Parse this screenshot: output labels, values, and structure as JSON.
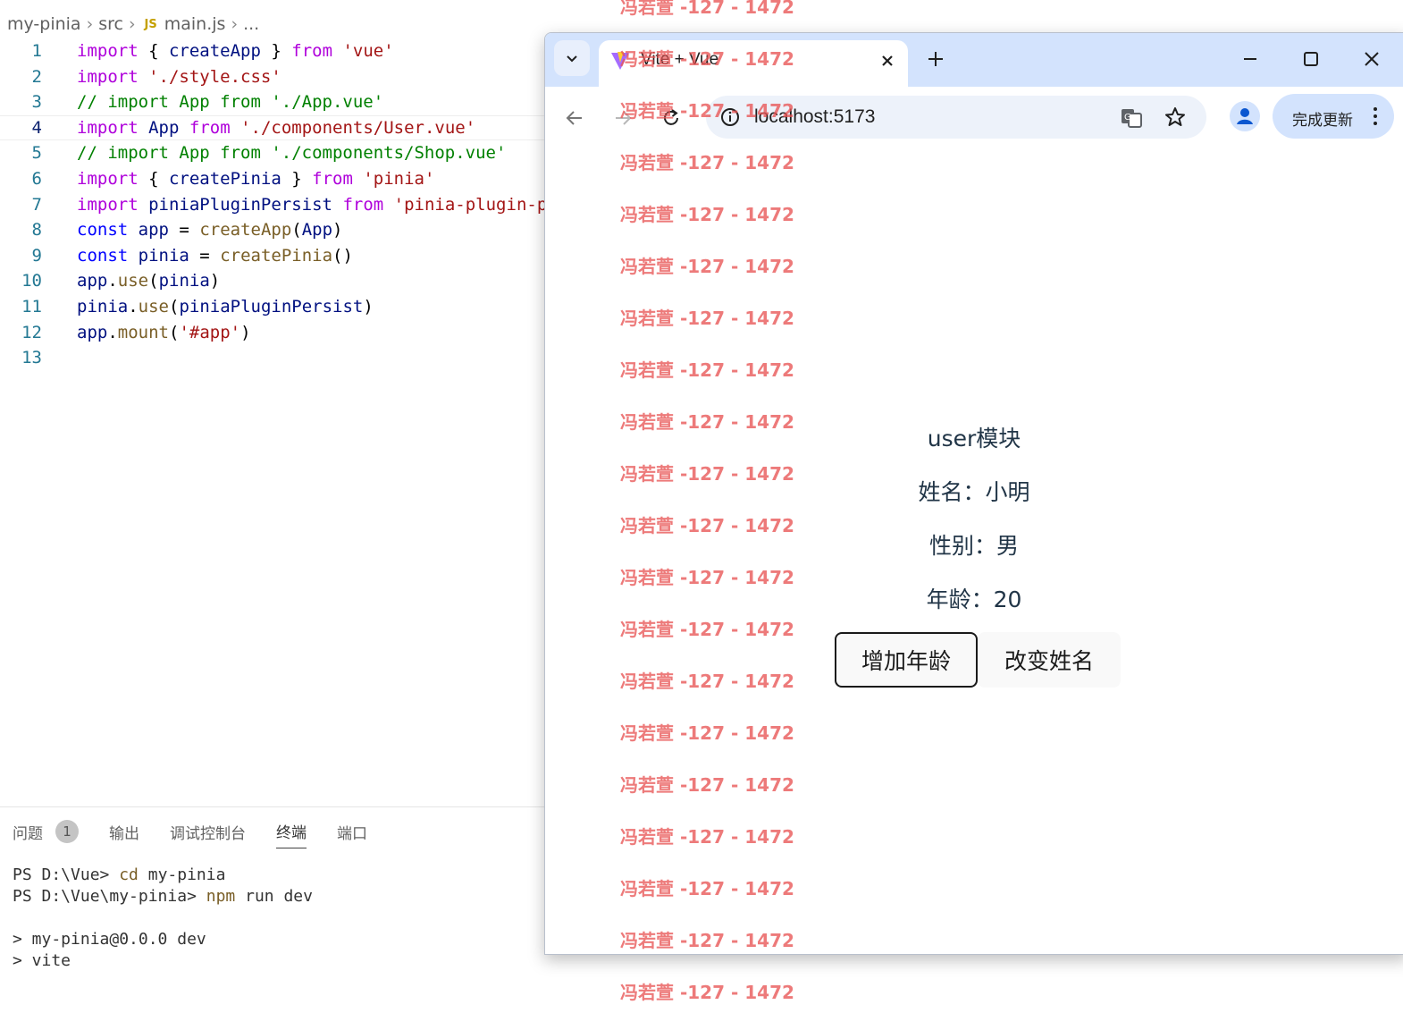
{
  "editor": {
    "breadcrumb": [
      "my-pinia",
      "src",
      "main.js",
      "..."
    ],
    "breadcrumb_file_badge": "JS",
    "lines": [
      {
        "num": "1",
        "tokens": [
          {
            "t": "import",
            "c": "t-imp"
          },
          {
            "t": " { "
          },
          {
            "t": "createApp",
            "c": "t-var"
          },
          {
            "t": " } "
          },
          {
            "t": "from",
            "c": "t-imp"
          },
          {
            "t": " "
          },
          {
            "t": "'vue'",
            "c": "t-str"
          }
        ]
      },
      {
        "num": "2",
        "tokens": [
          {
            "t": "import",
            "c": "t-imp"
          },
          {
            "t": " "
          },
          {
            "t": "'./style.css'",
            "c": "t-str"
          }
        ]
      },
      {
        "num": "3",
        "tokens": [
          {
            "t": "// import App from './App.vue'",
            "c": "t-com"
          }
        ]
      },
      {
        "num": "4",
        "current": true,
        "tokens": [
          {
            "t": "import",
            "c": "t-imp"
          },
          {
            "t": " "
          },
          {
            "t": "App",
            "c": "t-var"
          },
          {
            "t": " "
          },
          {
            "t": "from",
            "c": "t-imp"
          },
          {
            "t": " "
          },
          {
            "t": "'./components/User.vue'",
            "c": "t-str"
          }
        ]
      },
      {
        "num": "5",
        "tokens": [
          {
            "t": "// import App from './components/Shop.vue'",
            "c": "t-com"
          }
        ]
      },
      {
        "num": "6",
        "tokens": [
          {
            "t": "import",
            "c": "t-imp"
          },
          {
            "t": " { "
          },
          {
            "t": "createPinia",
            "c": "t-var"
          },
          {
            "t": " } "
          },
          {
            "t": "from",
            "c": "t-imp"
          },
          {
            "t": " "
          },
          {
            "t": "'pinia'",
            "c": "t-str"
          }
        ]
      },
      {
        "num": "7",
        "tokens": [
          {
            "t": "import",
            "c": "t-imp"
          },
          {
            "t": " "
          },
          {
            "t": "piniaPluginPersist",
            "c": "t-var"
          },
          {
            "t": " "
          },
          {
            "t": "from",
            "c": "t-imp"
          },
          {
            "t": " "
          },
          {
            "t": "'pinia-plugin-p",
            "c": "t-str"
          }
        ]
      },
      {
        "num": "8",
        "tokens": [
          {
            "t": "const",
            "c": "t-kw"
          },
          {
            "t": " "
          },
          {
            "t": "app",
            "c": "t-var"
          },
          {
            "t": " = "
          },
          {
            "t": "createApp",
            "c": "t-fn"
          },
          {
            "t": "("
          },
          {
            "t": "App",
            "c": "t-var"
          },
          {
            "t": ")"
          }
        ]
      },
      {
        "num": "9",
        "tokens": [
          {
            "t": "const",
            "c": "t-kw"
          },
          {
            "t": " "
          },
          {
            "t": "pinia",
            "c": "t-var"
          },
          {
            "t": " = "
          },
          {
            "t": "createPinia",
            "c": "t-fn"
          },
          {
            "t": "()"
          }
        ]
      },
      {
        "num": "10",
        "tokens": [
          {
            "t": "app",
            "c": "t-var"
          },
          {
            "t": "."
          },
          {
            "t": "use",
            "c": "t-fn"
          },
          {
            "t": "("
          },
          {
            "t": "pinia",
            "c": "t-var"
          },
          {
            "t": ")"
          }
        ]
      },
      {
        "num": "11",
        "tokens": [
          {
            "t": "pinia",
            "c": "t-var"
          },
          {
            "t": "."
          },
          {
            "t": "use",
            "c": "t-fn"
          },
          {
            "t": "("
          },
          {
            "t": "piniaPluginPersist",
            "c": "t-var"
          },
          {
            "t": ")"
          }
        ]
      },
      {
        "num": "12",
        "tokens": [
          {
            "t": "app",
            "c": "t-var"
          },
          {
            "t": "."
          },
          {
            "t": "mount",
            "c": "t-fn"
          },
          {
            "t": "("
          },
          {
            "t": "'#app'",
            "c": "t-str"
          },
          {
            "t": ")"
          }
        ]
      },
      {
        "num": "13",
        "tokens": []
      }
    ]
  },
  "panel": {
    "tabs": [
      {
        "label": "问题",
        "badge": "1"
      },
      {
        "label": "输出"
      },
      {
        "label": "调试控制台"
      },
      {
        "label": "终端",
        "active": true
      },
      {
        "label": "端口"
      }
    ],
    "terminal": [
      {
        "prompt": "PS D:\\Vue> ",
        "cmd": "cd",
        "rest": " my-pinia"
      },
      {
        "prompt": "PS D:\\Vue\\my-pinia> ",
        "cmd": "npm",
        "rest": " run dev"
      },
      {
        "prompt": "",
        "cmd": "",
        "rest": ""
      },
      {
        "prompt": "",
        "cmd": "",
        "rest": "> my-pinia@0.0.0 dev"
      },
      {
        "prompt": "",
        "cmd": "",
        "rest": "> vite"
      }
    ]
  },
  "browser": {
    "tab_title": "Vite + Vue",
    "url": "localhost:5173",
    "update_label": "完成更新",
    "accent": "#0b57d0"
  },
  "app": {
    "title": "user模块",
    "name_row": "姓名：小明",
    "gender_row": "性别：男",
    "age_row": "年龄：20",
    "btn_add_age": "增加年龄",
    "btn_change_name": "改变姓名"
  },
  "watermark": {
    "text": "冯若萱 -127 - 1472",
    "color": "#e85454"
  }
}
